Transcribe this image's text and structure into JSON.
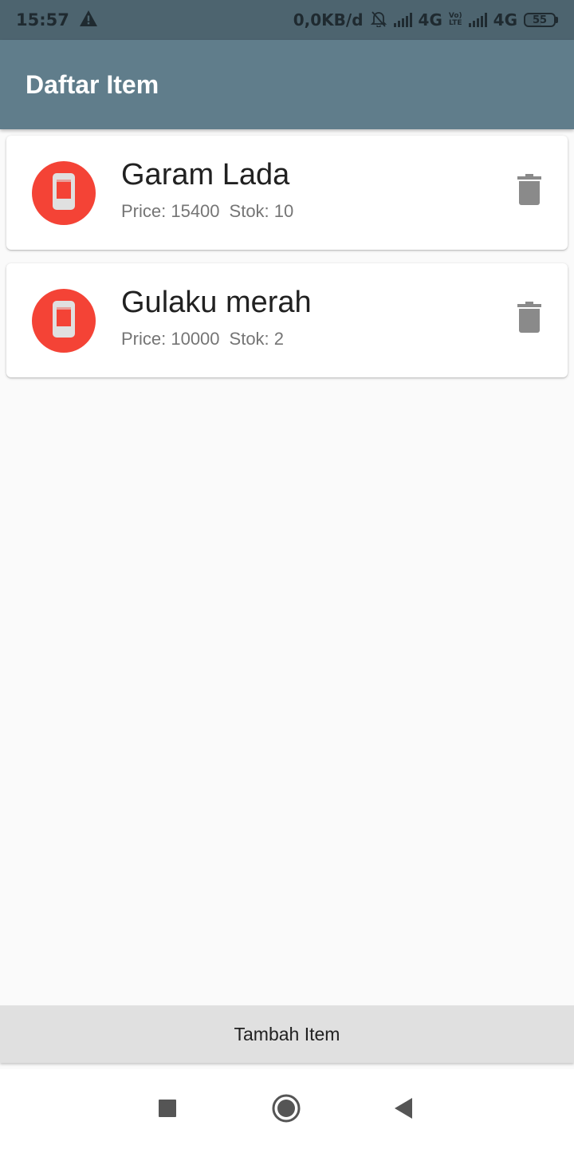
{
  "status_bar": {
    "time": "15:57",
    "data_speed": "0,0KB/d",
    "network_1": "4G",
    "volte_top": "Vo)",
    "volte_bottom": "LTE",
    "network_2": "4G",
    "battery": "55",
    "battery_level": 0.55
  },
  "app_bar": {
    "title": "Daftar Item"
  },
  "items": [
    {
      "name": "Garam Lada",
      "price": "Price: 15400",
      "stock": "Stok: 10"
    },
    {
      "name": "Gulaku merah",
      "price": "Price: 10000",
      "stock": "Stok: 2"
    }
  ],
  "add_button": {
    "label": "Tambah Item"
  },
  "colors": {
    "status_bar": "#4d646f",
    "app_bar": "#607d8b",
    "avatar": "#f44336",
    "background": "#fafafa",
    "button": "#e0e0e0"
  }
}
